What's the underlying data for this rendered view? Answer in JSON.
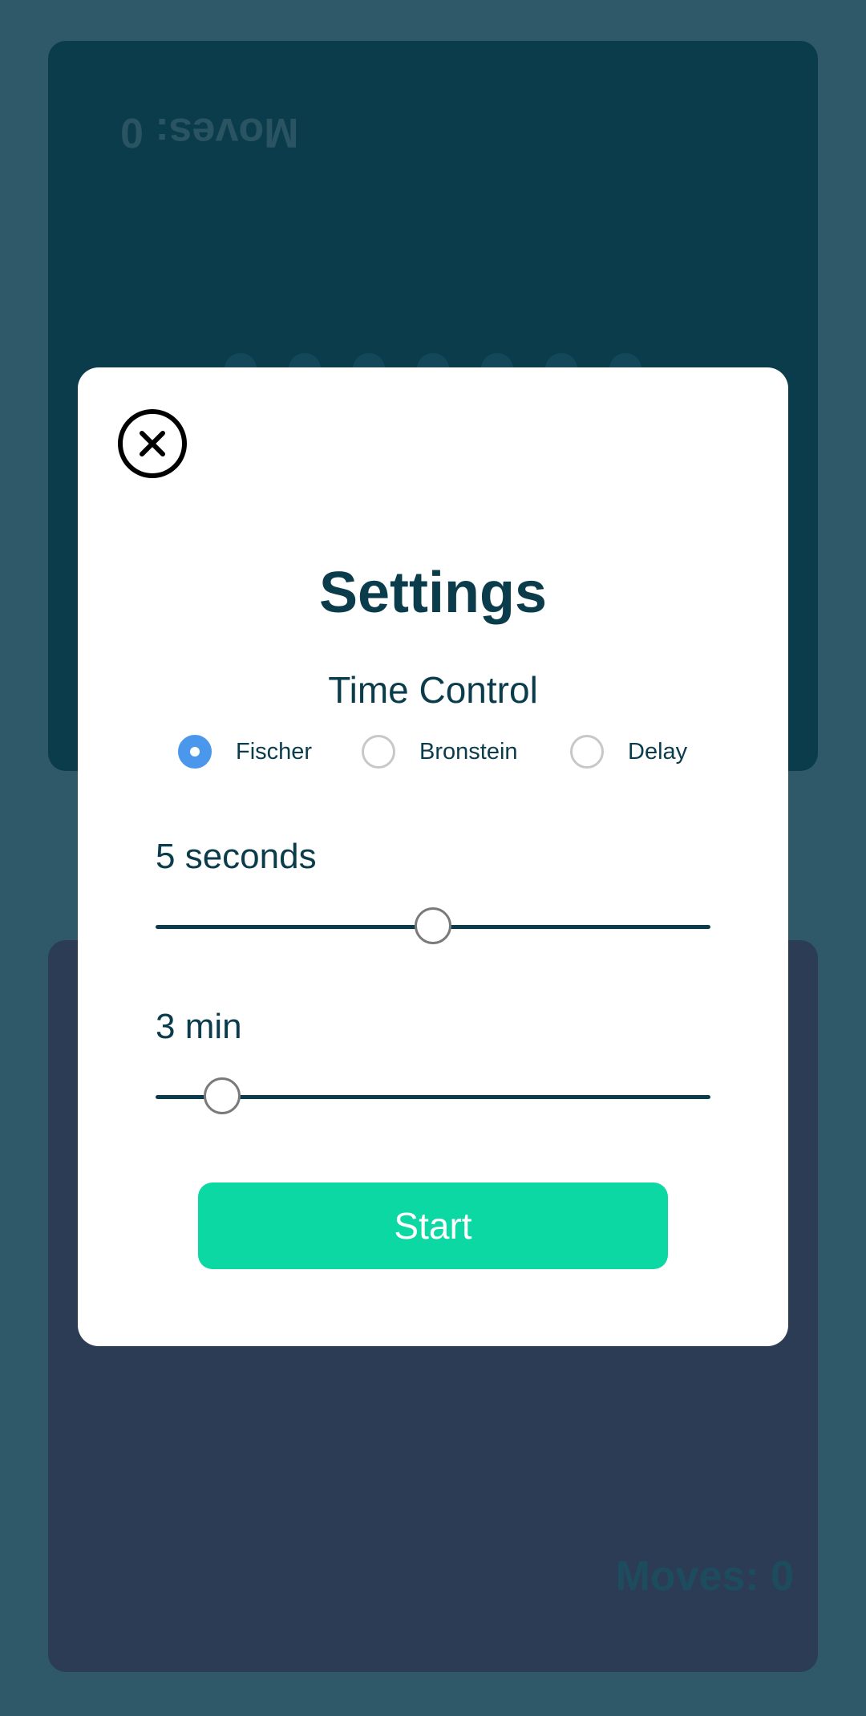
{
  "board": {
    "top_moves": "Moves: 0",
    "bottom_moves": "Moves: 0"
  },
  "settings": {
    "close_icon": "close-circle-icon",
    "title": "Settings",
    "time_control_label": "Time Control",
    "options": [
      {
        "label": "Fischer",
        "selected": true
      },
      {
        "label": "Bronstein",
        "selected": false
      },
      {
        "label": "Delay",
        "selected": false
      }
    ],
    "increment": {
      "label": "5 seconds",
      "level": 0.5
    },
    "base_time": {
      "label": "3 min",
      "level": 0.12
    },
    "start_label": "Start"
  },
  "colors": {
    "accent": "#0bd8a2",
    "radio_selected": "#4a97ec",
    "text": "#0b3c4b",
    "top_panel": "#0b3c4b",
    "bottom_panel": "#2c3c55",
    "background": "#2f5968"
  }
}
